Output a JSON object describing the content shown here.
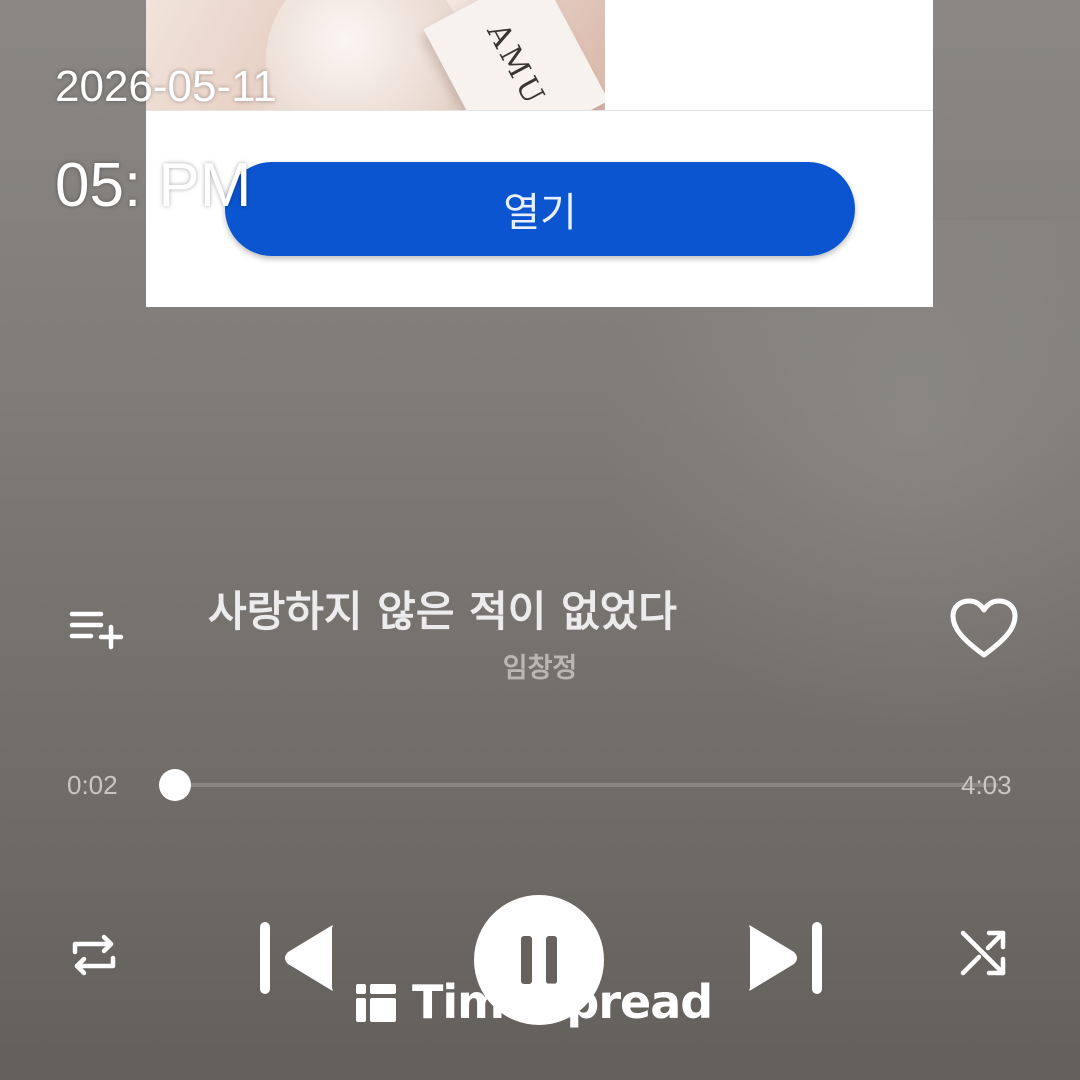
{
  "overlay": {
    "date": "2026-05-11",
    "time": "05:  PM"
  },
  "ad": {
    "brand_text": "AMU",
    "open_button_label": "열기",
    "button_color": "#0b56d0"
  },
  "track": {
    "title": "사랑하지 않은 적이 없었다",
    "artist": "임창정"
  },
  "progress": {
    "elapsed": "0:02",
    "total": "4:03",
    "fraction": 0.008
  },
  "controls": {
    "add_to_playlist_icon": "playlist-add-icon",
    "like_icon": "heart-outline-icon",
    "repeat_icon": "repeat-icon",
    "previous_icon": "skip-previous-icon",
    "play_state_icon": "pause-icon",
    "next_icon": "skip-next-icon",
    "shuffle_icon": "shuffle-icon"
  },
  "watermark": {
    "text": "TimeSpread"
  }
}
